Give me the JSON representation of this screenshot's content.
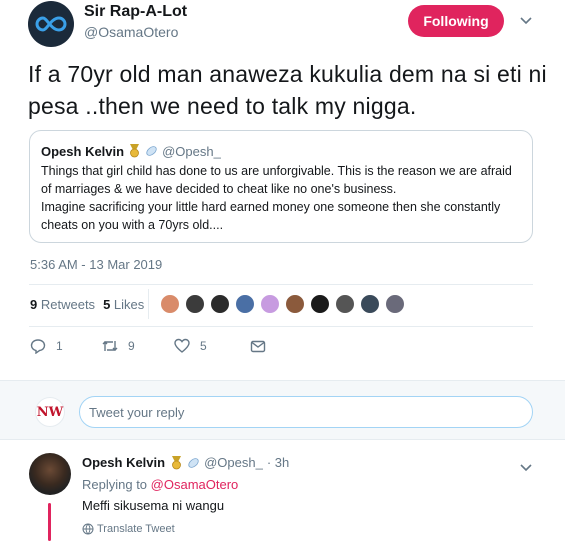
{
  "tweet": {
    "author_name": "Sir Rap-A-Lot",
    "author_handle": "@OsamaOtero",
    "follow_label": "Following",
    "text": "If a 70yr old man anaweza kukulia  dem na si eti ni pesa ..then we need to talk my nigga.",
    "timestamp": "5:36 AM - 13 Mar 2019",
    "retweets_count": "9",
    "retweets_label": "Retweets",
    "likes_count": "5",
    "likes_label": "Likes",
    "reply_count": "1",
    "retweet_count": "9",
    "like_count": "5",
    "accent_color": "#e0245e"
  },
  "quote": {
    "name": "Opesh Kelvin",
    "handle": "@Opesh_",
    "text_1": "Things that girl child has done to us are unforgivable. This is the reason we are afraid of marriages & we have decided to cheat like no one's business.",
    "text_2": "Imagine sacrificing your little hard earned money one someone then she constantly cheats on you with a 70yrs old...."
  },
  "reply_box": {
    "avatar_text": "NW",
    "placeholder": "Tweet your reply"
  },
  "reply": {
    "name": "Opesh Kelvin",
    "handle": "@Opesh_",
    "time": "· 3h",
    "replying_prefix": "Replying to",
    "replying_to": "@OsamaOtero",
    "text": "Meffi sikusema ni wangu",
    "translate_label": "Translate Tweet"
  },
  "likers": [
    {
      "name": "liker-1",
      "color": "#d98b6a"
    },
    {
      "name": "liker-2",
      "color": "#3b3b3b"
    },
    {
      "name": "liker-3",
      "color": "#2b2b2b"
    },
    {
      "name": "liker-4",
      "color": "#4a6fa5"
    },
    {
      "name": "liker-5",
      "color": "#c79be0"
    },
    {
      "name": "liker-6",
      "color": "#8b5a3c"
    },
    {
      "name": "liker-7",
      "color": "#1a1a1a"
    },
    {
      "name": "liker-8",
      "color": "#555555"
    },
    {
      "name": "liker-9",
      "color": "#3a4a5a"
    },
    {
      "name": "liker-10",
      "color": "#6a6a7a"
    }
  ]
}
